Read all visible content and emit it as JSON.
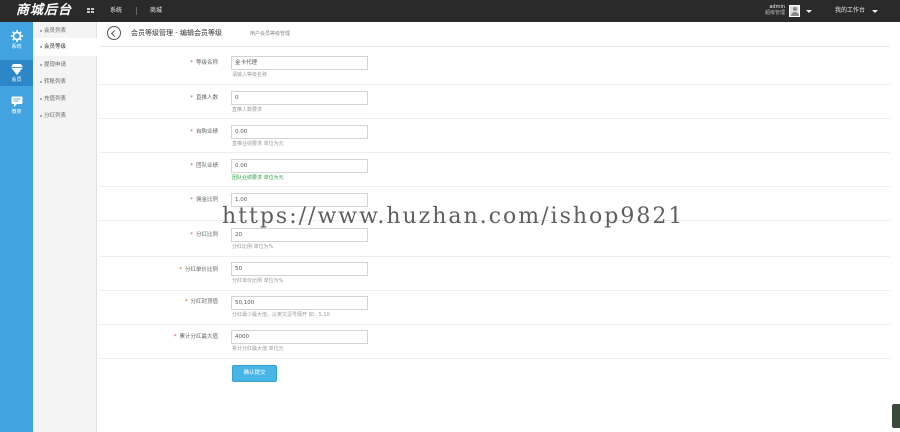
{
  "topbar": {
    "logo": "商城后台",
    "nav": [
      "系统",
      "商城"
    ],
    "admin_name": "admin",
    "admin_role": "超级管理",
    "workbench_label": "我的工作台"
  },
  "iconbar": [
    {
      "label": "系统",
      "icon": "gear-icon"
    },
    {
      "label": "会员",
      "icon": "diamond-icon"
    },
    {
      "label": "微商",
      "icon": "chat-icon"
    }
  ],
  "submenu": [
    "会员列表",
    "会员等级",
    "提现申请",
    "转账列表",
    "充值列表",
    "分红列表"
  ],
  "header": {
    "title": "会员等级管理 - 编辑会员等级",
    "desc": "用户会员等级管理"
  },
  "form": {
    "rows": [
      {
        "label": "等级名称",
        "value": "金卡代理",
        "help": "请输入等级名称"
      },
      {
        "label": "直推人数",
        "value": "0",
        "help": "直推人数要求"
      },
      {
        "label": "自购业绩",
        "value": "0.00",
        "help": "直推业绩要求  单位为元"
      },
      {
        "label": "团队业绩",
        "value": "0.00",
        "help": "团队业绩要求  单位为元"
      },
      {
        "label": "佣金比例",
        "value": "1.00",
        "help": ""
      },
      {
        "label": "分红比例",
        "value": "20",
        "help": "分红比例  单位为%"
      },
      {
        "label": "分红单价比例",
        "value": "50",
        "help": "分红单价比例  单位为%"
      },
      {
        "label": "分红封顶值",
        "value": "50,100",
        "help": "分红最少最大值，以英文逗号隔开 如：5,10"
      },
      {
        "label": "累计分红最大值",
        "value": "4000",
        "help": "累计分红最大值  单位元"
      }
    ],
    "submit_label": "确认提交"
  },
  "watermark": "https://www.huzhan.com/ishop9821",
  "colors": {
    "topbar": "#2a2a2a",
    "iconbar": "#43a3e0",
    "submit": "#47b6e6",
    "required_star": "#e64a19"
  }
}
